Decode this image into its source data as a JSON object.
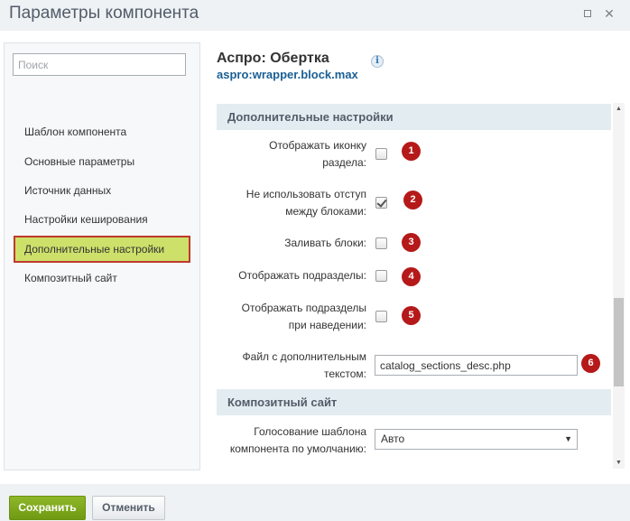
{
  "window": {
    "title": "Параметры компонента",
    "maximize_icon": "maximize-icon",
    "close_icon": "close-icon"
  },
  "sidebar": {
    "search_placeholder": "Поиск",
    "items": [
      {
        "label": "Шаблон компонента",
        "active": false
      },
      {
        "label": "Основные параметры",
        "active": false
      },
      {
        "label": "Источник данных",
        "active": false
      },
      {
        "label": "Настройки кеширования",
        "active": false
      },
      {
        "label": "Дополнительные настройки",
        "active": true
      },
      {
        "label": "Композитный сайт",
        "active": false
      }
    ]
  },
  "component": {
    "title": "Аспро: Обертка",
    "code": "aspro:wrapper.block.max",
    "info_icon": "i"
  },
  "sections": {
    "additional": {
      "title": "Дополнительные настройки",
      "fields": [
        {
          "label_lines": [
            "Отображать иконку",
            "раздела:"
          ],
          "checked": false,
          "badge": "1"
        },
        {
          "label_lines": [
            "Не использовать отступ",
            "между блоками:"
          ],
          "checked": true,
          "badge": "2"
        },
        {
          "label_lines": [
            "Заливать блоки:"
          ],
          "checked": false,
          "badge": "3"
        },
        {
          "label_lines": [
            "Отображать подразделы:"
          ],
          "checked": false,
          "badge": "4"
        },
        {
          "label_lines": [
            "Отображать подразделы",
            "при наведении:"
          ],
          "checked": false,
          "badge": "5"
        },
        {
          "label_lines": [
            "Файл с дополнительным",
            "текстом:"
          ],
          "value": "catalog_sections_desc.php",
          "badge": "6"
        }
      ]
    },
    "composite": {
      "title": "Композитный сайт",
      "field": {
        "label_lines": [
          "Голосование шаблона",
          "компонента по умолчанию:"
        ],
        "value": "Авто"
      }
    }
  },
  "footer": {
    "save_label": "Сохранить",
    "cancel_label": "Отменить"
  },
  "colors": {
    "badge": "#b51919",
    "active_nav_bg": "#cde06a",
    "active_nav_border": "#c0392b",
    "save_button": "#7ba71d",
    "code_link": "#1b5f94"
  }
}
